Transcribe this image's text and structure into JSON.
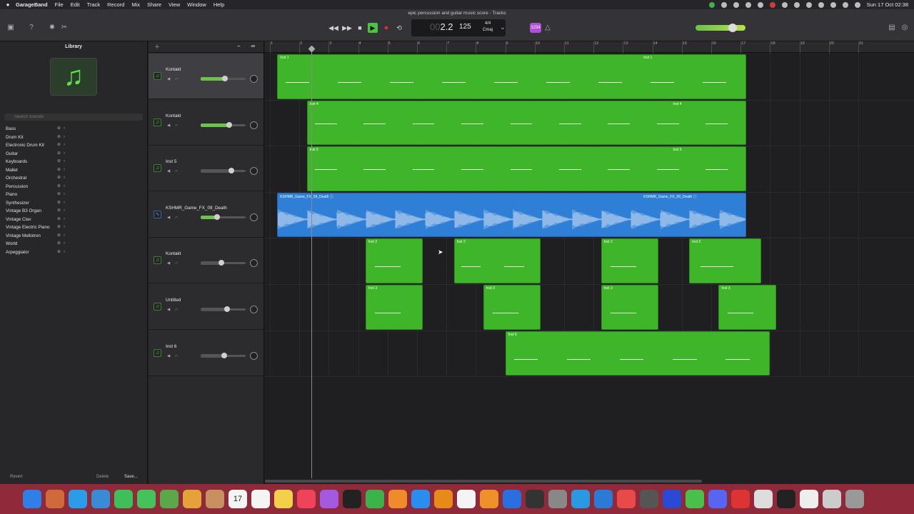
{
  "menubar": {
    "apple": "",
    "app_name": "GarageBand",
    "items": [
      "File",
      "Edit",
      "Track",
      "Record",
      "Mix",
      "Share",
      "View",
      "Window",
      "Help"
    ],
    "clock": "Sun 17 Oct  02:38"
  },
  "window": {
    "title": "epic percussion and guitar music score - Tracks"
  },
  "lcd": {
    "position_dim": "00",
    "position": "2.2",
    "tempo": "125",
    "time_sig": "4/4",
    "key": "Cmaj"
  },
  "count_in": "1234",
  "library": {
    "title": "Library",
    "search_placeholder": "Search Sounds",
    "items": [
      "Bass",
      "Drum Kit",
      "Electronic Drum Kit",
      "Guitar",
      "Keyboards",
      "Mallet",
      "Orchestral",
      "Percussion",
      "Piano",
      "Synthesizer",
      "Vintage B3 Organ",
      "Vintage Clav",
      "Vintage Electric Piano",
      "Vintage Mellotron",
      "World",
      "Arpeggiator"
    ],
    "footer": {
      "revert": "Revert",
      "delete": "Delete",
      "save": "Save..."
    }
  },
  "tracks": [
    {
      "name": "Kontakt",
      "type": "software",
      "volume": 0.55,
      "selected": true
    },
    {
      "name": "Kontakt",
      "type": "software",
      "volume": 0.65,
      "selected": false
    },
    {
      "name": "Inst 5",
      "type": "software",
      "volume": 0.7,
      "selected": false
    },
    {
      "name": "KSHMR_Game_FX_09_Death",
      "type": "audio",
      "volume": 0.35,
      "selected": false
    },
    {
      "name": "Kontakt",
      "type": "software",
      "volume": 0.45,
      "selected": false
    },
    {
      "name": "Untitled",
      "type": "software",
      "volume": 0.6,
      "selected": false
    },
    {
      "name": "Inst 6",
      "type": "software",
      "volume": 0.52,
      "selected": false
    }
  ],
  "ruler": {
    "bars": [
      "1",
      "2",
      "3",
      "4",
      "5",
      "6",
      "7",
      "8",
      "9",
      "10",
      "11",
      "12",
      "13",
      "14",
      "15",
      "16",
      "17",
      "18",
      "19",
      "20",
      "21"
    ]
  },
  "regions": [
    {
      "track": 0,
      "start_bar": 1.25,
      "end_bar": 17.2,
      "labels": [
        {
          "bar": 1.25,
          "text": "Inst 1"
        },
        {
          "bar": 13.6,
          "text": "Inst 1"
        }
      ]
    },
    {
      "track": 1,
      "start_bar": 2.25,
      "end_bar": 17.2,
      "labels": [
        {
          "bar": 2.25,
          "text": "Inst 4"
        },
        {
          "bar": 14.6,
          "text": "Inst 4"
        }
      ]
    },
    {
      "track": 2,
      "start_bar": 2.25,
      "end_bar": 17.2,
      "labels": [
        {
          "bar": 2.25,
          "text": "Inst 5"
        },
        {
          "bar": 14.6,
          "text": "Inst 5"
        }
      ]
    },
    {
      "track": 3,
      "start_bar": 1.25,
      "end_bar": 17.2,
      "audio": true,
      "labels": [
        {
          "bar": 1.25,
          "text": "KSHMR_Game_FX_09_Death  ⓘ"
        },
        {
          "bar": 13.6,
          "text": "KSHMR_Game_FX_09_Death  ⓘ"
        }
      ]
    },
    {
      "track": 4,
      "start_bar": 4.25,
      "end_bar": 6.2,
      "labels": [
        {
          "bar": 4.25,
          "text": "Inst 2"
        }
      ]
    },
    {
      "track": 4,
      "start_bar": 7.25,
      "end_bar": 10.2,
      "labels": [
        {
          "bar": 7.25,
          "text": "Inst 2"
        }
      ]
    },
    {
      "track": 4,
      "start_bar": 12.25,
      "end_bar": 14.2,
      "labels": [
        {
          "bar": 12.25,
          "text": "Inst 2"
        }
      ]
    },
    {
      "track": 4,
      "start_bar": 15.25,
      "end_bar": 17.7,
      "labels": [
        {
          "bar": 15.25,
          "text": "Inst 2"
        }
      ]
    },
    {
      "track": 5,
      "start_bar": 4.25,
      "end_bar": 6.2,
      "labels": [
        {
          "bar": 4.25,
          "text": "Inst 3"
        }
      ]
    },
    {
      "track": 5,
      "start_bar": 8.25,
      "end_bar": 10.2,
      "labels": [
        {
          "bar": 8.25,
          "text": "Inst 3"
        }
      ]
    },
    {
      "track": 5,
      "start_bar": 12.25,
      "end_bar": 14.2,
      "labels": [
        {
          "bar": 12.25,
          "text": "Inst 3"
        }
      ]
    },
    {
      "track": 5,
      "start_bar": 16.25,
      "end_bar": 18.2,
      "labels": [
        {
          "bar": 16.25,
          "text": "Inst 3"
        }
      ]
    },
    {
      "track": 6,
      "start_bar": 9.0,
      "end_bar": 18.0,
      "labels": [
        {
          "bar": 9.0,
          "text": "Inst 6"
        }
      ]
    }
  ],
  "playhead_bar": 2.4,
  "dock": {
    "icons": [
      "finder",
      "launchpad",
      "safari",
      "mail",
      "facetime",
      "messages",
      "maps",
      "photos",
      "contacts",
      "calendar",
      "reminders",
      "notes",
      "music",
      "podcasts",
      "tv",
      "numbers",
      "pages",
      "app-store",
      "fl-studio",
      "chrome",
      "garageband",
      "keynote",
      "logic",
      "settings",
      "vpn",
      "edge",
      "cloud",
      "help",
      "ru",
      "utorrent",
      "discord",
      "audio-app",
      "hy",
      "piano-app",
      "document",
      "folder",
      "trash"
    ],
    "calendar_day": "17"
  }
}
